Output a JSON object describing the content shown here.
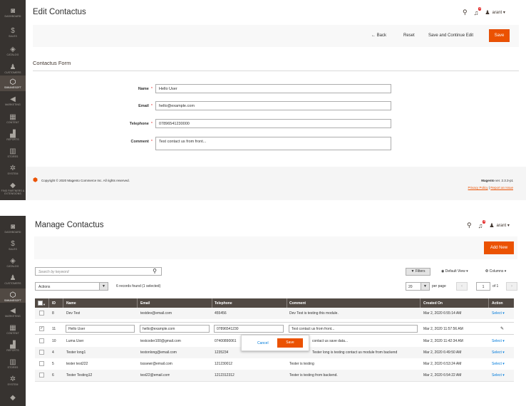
{
  "sidebar_top": {
    "items": [
      {
        "label": "DASHBOARD",
        "icon": "dashboard-icon",
        "glyph": "◙"
      },
      {
        "label": "SALES",
        "icon": "dollar-icon",
        "glyph": "$"
      },
      {
        "label": "CATALOG",
        "icon": "cube-icon",
        "glyph": "◈"
      },
      {
        "label": "CUSTOMERS",
        "icon": "person-icon",
        "glyph": "♟"
      },
      {
        "label": "SIMUNESOFT",
        "icon": "hexagon-icon",
        "glyph": "⬡"
      },
      {
        "label": "MARKETING",
        "icon": "megaphone-icon",
        "glyph": "◀"
      },
      {
        "label": "CONTENT",
        "icon": "content-icon",
        "glyph": "▦"
      },
      {
        "label": "REPORTS",
        "icon": "bar-chart-icon",
        "glyph": "▟"
      },
      {
        "label": "STORES",
        "icon": "store-icon",
        "glyph": "▥"
      },
      {
        "label": "SYSTEM",
        "icon": "gear-icon",
        "glyph": "✲"
      },
      {
        "label": "FIND PARTNERS & EXTENSIONS",
        "icon": "puzzle-icon",
        "glyph": "◆"
      }
    ]
  },
  "sidebar_bottom": {
    "items": [
      {
        "label": "DASHBOARD",
        "icon": "dashboard-icon",
        "glyph": "◙"
      },
      {
        "label": "SALES",
        "icon": "dollar-icon",
        "glyph": "$"
      },
      {
        "label": "CATALOG",
        "icon": "cube-icon",
        "glyph": "◈"
      },
      {
        "label": "CUSTOMERS",
        "icon": "person-icon",
        "glyph": "♟"
      },
      {
        "label": "SIMUNESOFT",
        "icon": "hexagon-icon",
        "glyph": "⬡"
      },
      {
        "label": "MARKETING",
        "icon": "megaphone-icon",
        "glyph": "◀"
      },
      {
        "label": "CONTENT",
        "icon": "content-icon",
        "glyph": "▦"
      },
      {
        "label": "REPORTS",
        "icon": "bar-chart-icon",
        "glyph": "▟"
      },
      {
        "label": "STORES",
        "icon": "store-icon",
        "glyph": "▥"
      },
      {
        "label": "SYSTEM",
        "icon": "gear-icon",
        "glyph": "✲"
      },
      {
        "label": "",
        "icon": "puzzle-icon",
        "glyph": "◆"
      }
    ]
  },
  "header": {
    "user": "arant ▾",
    "notifications": "2"
  },
  "edit": {
    "title": "Edit Contactus",
    "back": "← Back",
    "reset": "Reset",
    "save_continue": "Save and Continue Edit",
    "save": "Save",
    "section": "Contactus Form",
    "fields": [
      {
        "label": "Name",
        "value": "Hello User"
      },
      {
        "label": "Email",
        "value": "hello@example.com"
      },
      {
        "label": "Telephone",
        "value": "07896541230000"
      },
      {
        "label": "Comment",
        "value": "Test contact us from front..."
      }
    ],
    "footer": {
      "copyright": "Copyright © 2020 Magento Commerce Inc. All rights reserved.",
      "brand": "Magento",
      "version": " ver. 2.3.3-p1",
      "privacy": "Privacy Policy",
      "sep": " | ",
      "report": "Report an Issue"
    }
  },
  "grid": {
    "title": "Manage Contactus",
    "add_new": "Add New",
    "search_placeholder": "Search by keyword",
    "filters": "Filters",
    "default_view": "Default View ▾",
    "columns": "Columns ▾",
    "actions": "Actions",
    "records": "6 records found (1 selected)",
    "per_page_value": "20",
    "per_page_label": "per page",
    "page": "1",
    "of_pages": "of 1",
    "columns_head": [
      "ID",
      "Name",
      "Email",
      "Telephone",
      "Comment",
      "Created On",
      "Action"
    ],
    "rows": [
      {
        "id": "8",
        "name": "Dev Test",
        "email": "testdev@email.com",
        "tel": "455456",
        "comment": "Dev Test is testing this module.",
        "created": "Mar 2, 2020 6:55:14 AM",
        "action": "Select ▾"
      },
      {
        "id": "11",
        "name": "Hello User",
        "email": "hello@example.com",
        "tel": "07896541230",
        "comment": "Test contact us from front...",
        "created": "Mar 2, 2020 11:57:56 AM",
        "action": "✎"
      },
      {
        "id": "10",
        "name": "Luma User",
        "email": "testcoder100@gmail.com",
        "tel": "07400890061",
        "comment": "contact us save data...",
        "created": "Mar 2, 2020 11:42:34 AM",
        "action": "Select ▾"
      },
      {
        "id": "4",
        "name": "Tester long1",
        "email": "testonlong@email.com",
        "tel": "1235234",
        "comment": "Tester long is testing contact us module from backend",
        "created": "Mar 2, 2020 6:49:50 AM",
        "action": "Select ▾"
      },
      {
        "id": "5",
        "name": "tester test222",
        "email": "tsssewr@email.com",
        "tel": "121230012",
        "comment": "Tester is testing",
        "created": "Mar 2, 2020 6:53:24 AM",
        "action": "Select ▾"
      },
      {
        "id": "6",
        "name": "Tester Testing12",
        "email": "test22@email.com",
        "tel": "1212312312",
        "comment": "Tester is testing from backend.",
        "created": "Mar 2, 2020 6:54:22 AM",
        "action": "Select ▾"
      }
    ],
    "inline": {
      "cancel": "Cancel",
      "save": "Save"
    }
  },
  "colors": {
    "accent": "#eb5202",
    "sidebar": "#373330",
    "grid_header": "#514943",
    "link": "#007bdb"
  }
}
